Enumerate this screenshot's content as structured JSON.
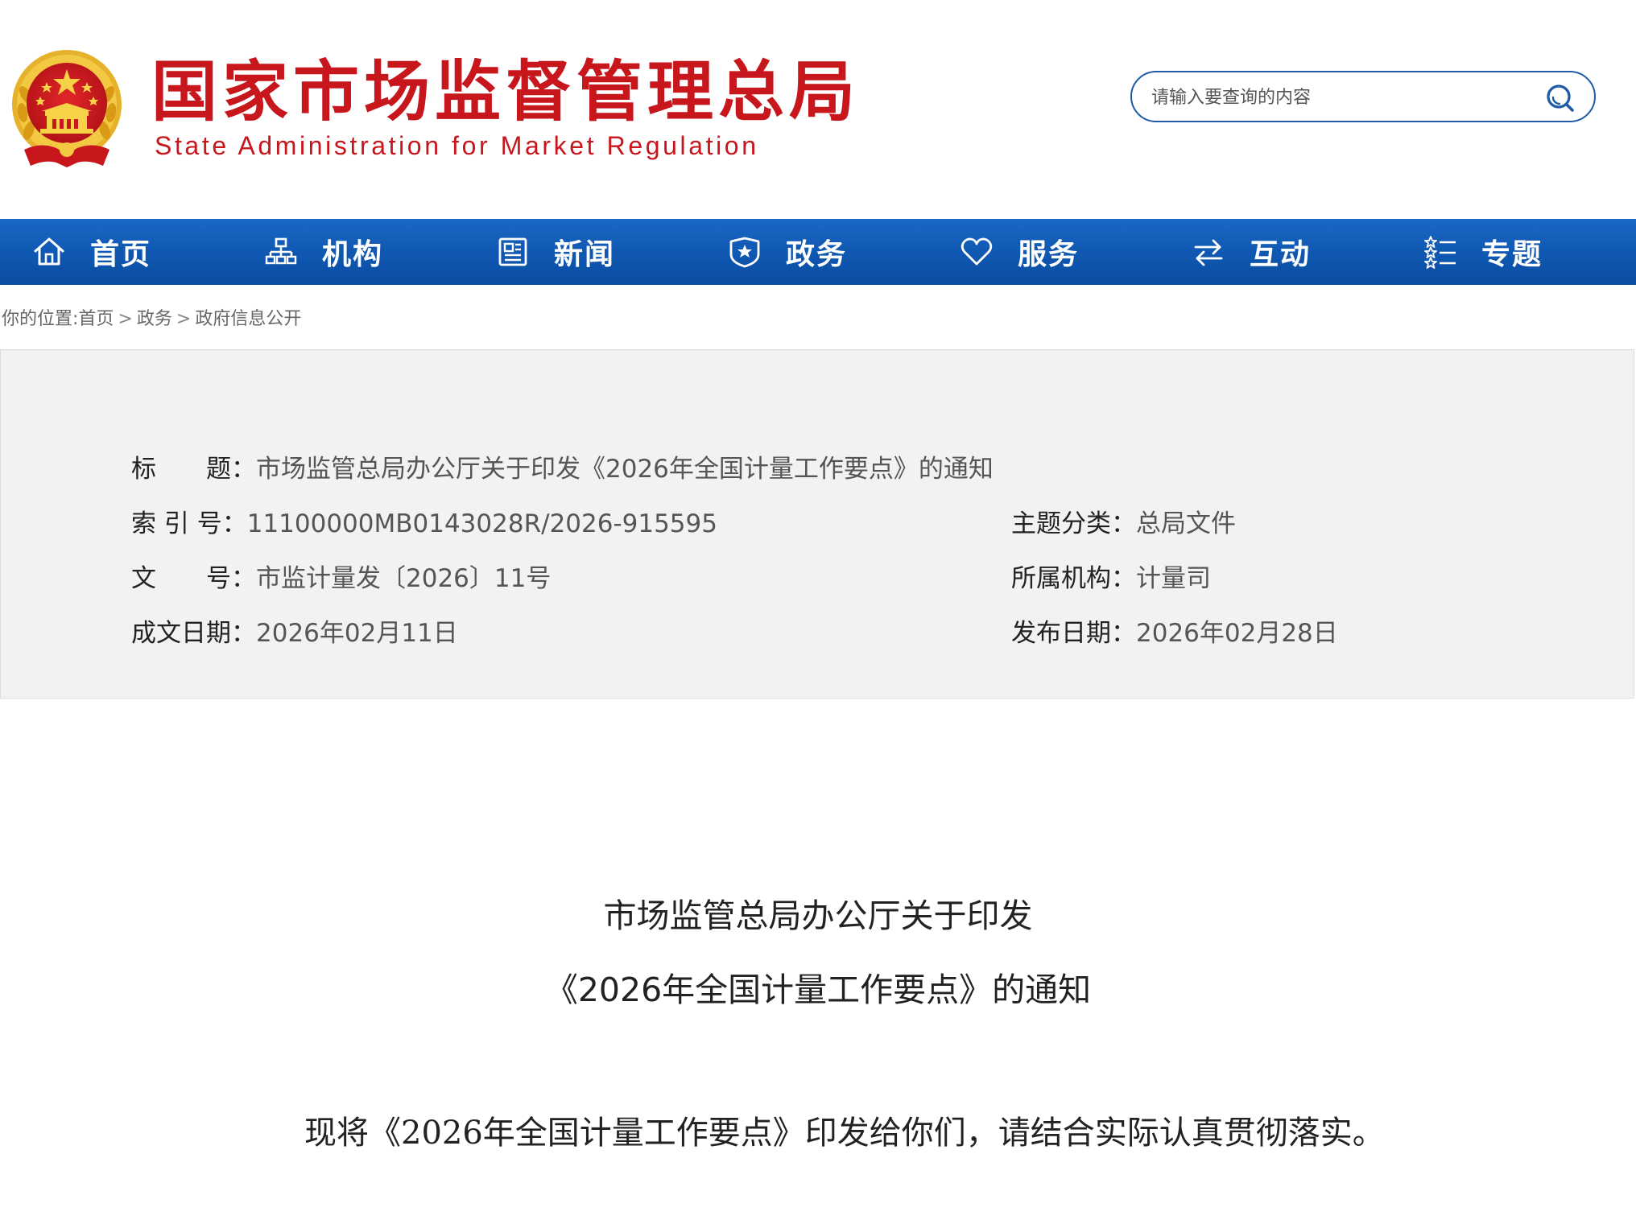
{
  "header": {
    "title_zh": "国家市场监督管理总局",
    "title_en": "State Administration for Market Regulation",
    "search_placeholder": "请输入要查询的内容",
    "colors": {
      "brand_red": "#c8161d",
      "nav_blue": "#0f57b1",
      "search_border": "#1d5ba7"
    }
  },
  "nav": {
    "items": [
      {
        "label": "首页",
        "icon": "home-icon"
      },
      {
        "label": "机构",
        "icon": "org-chart-icon"
      },
      {
        "label": "新闻",
        "icon": "newspaper-icon"
      },
      {
        "label": "政务",
        "icon": "shield-star-icon"
      },
      {
        "label": "服务",
        "icon": "heart-icon"
      },
      {
        "label": "互动",
        "icon": "exchange-arrows-icon"
      },
      {
        "label": "专题",
        "icon": "star-list-icon"
      }
    ]
  },
  "breadcrumb": {
    "prefix": "你的位置:",
    "items": [
      "首页",
      "政务",
      "政府信息公开"
    ],
    "separator": ">"
  },
  "meta": {
    "title_label": "标　　题：",
    "title_value": "市场监管总局办公厅关于印发《2026年全国计量工作要点》的通知",
    "index_label": "索 引 号：",
    "index_value": "11100000MB0143028R/2026-915595",
    "topic_label": "主题分类：",
    "topic_value": "总局文件",
    "docno_label": "文　　号：",
    "docno_value": "市监计量发〔2026〕11号",
    "org_label": "所属机构：",
    "org_value": "计量司",
    "created_label": "成文日期：",
    "created_value": "2026年02月11日",
    "published_label": "发布日期：",
    "published_value": "2026年02月28日"
  },
  "document": {
    "title_line1": "市场监管总局办公厅关于印发",
    "title_line2": "《2026年全国计量工作要点》的通知",
    "paragraph1": "现将《2026年全国计量工作要点》印发给你们，请结合实际认真贯彻落实。"
  }
}
